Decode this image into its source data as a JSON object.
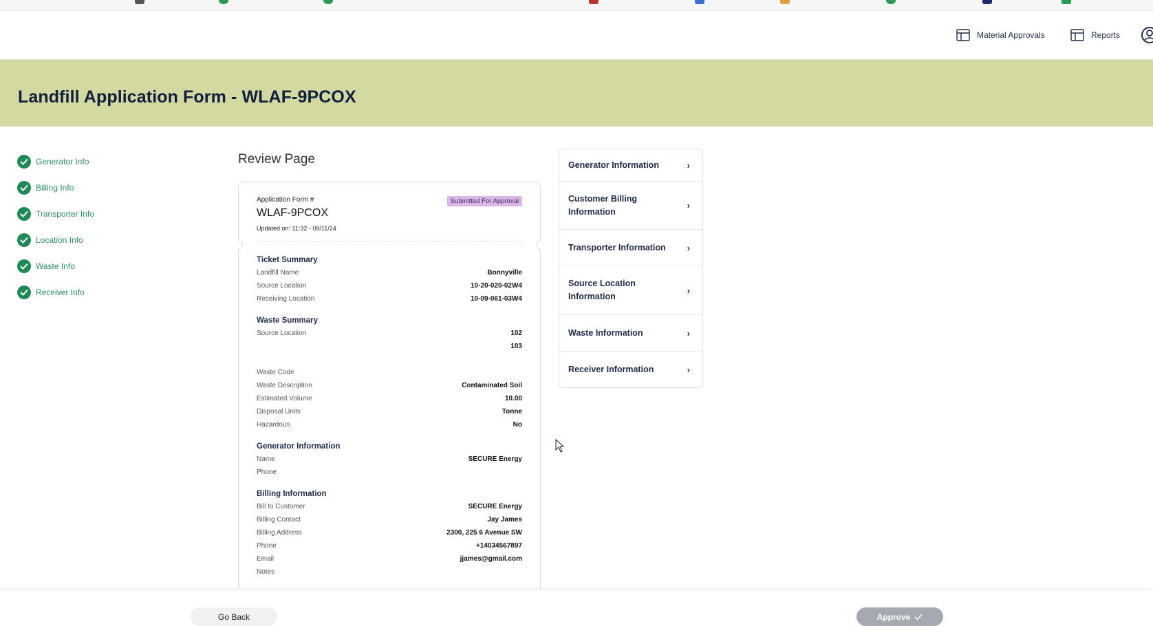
{
  "topbar": {
    "links": [
      {
        "label": "Material Approvals",
        "icon": "table-icon"
      },
      {
        "label": "Reports",
        "icon": "table-icon"
      }
    ],
    "user_icon": "user-circle-icon"
  },
  "banner": {
    "title": "Landfill Application Form - WLAF-9PCOX"
  },
  "steps": [
    {
      "label": "Generator Info",
      "status": "complete"
    },
    {
      "label": "Billing Info",
      "status": "complete"
    },
    {
      "label": "Transporter Info",
      "status": "complete"
    },
    {
      "label": "Location Info",
      "status": "complete"
    },
    {
      "label": "Waste Info",
      "status": "complete"
    },
    {
      "label": "Receiver Info",
      "status": "complete"
    }
  ],
  "review": {
    "title": "Review Page",
    "app_label": "Application Form #",
    "app_number": "WLAF-9PCOX",
    "updated": "Updated on: 11:32 - 09/11/24",
    "status": "Submitted For Approval",
    "ticket_summary": {
      "title": "Ticket Summary",
      "rows": [
        {
          "k": "Landfill Name",
          "v": "Bonnyville"
        },
        {
          "k": "Source Location",
          "v": "10-20-020-02W4"
        },
        {
          "k": "Receiving Location",
          "v": "10-09-061-03W4"
        }
      ]
    },
    "waste_summary": {
      "title": "Waste Summary",
      "rows": [
        {
          "k": "Source Location",
          "v": "102"
        },
        {
          "k": "",
          "v": "103"
        },
        {
          "k": "Waste Code",
          "v": ""
        },
        {
          "k": "Waste Description",
          "v": "Contaminated Soil"
        },
        {
          "k": "Estimated Volume",
          "v": "10.00"
        },
        {
          "k": "Disposal Units",
          "v": "Tonne"
        },
        {
          "k": "Hazardous",
          "v": "No"
        }
      ]
    },
    "generator_info": {
      "title": "Generator Information",
      "rows": [
        {
          "k": "Name",
          "v": "SECURE Energy"
        },
        {
          "k": "Phone",
          "v": ""
        }
      ]
    },
    "billing_info": {
      "title": "Billing Information",
      "rows": [
        {
          "k": "Bill to Customer",
          "v": "SECURE Energy"
        },
        {
          "k": "Billing Contact",
          "v": "Jay James"
        },
        {
          "k": "Billing Address",
          "v": "2300, 225 6 Avenue SW"
        },
        {
          "k": "Phone",
          "v": "+14034567897"
        },
        {
          "k": "Email",
          "v": "jjames@gmail.com"
        },
        {
          "k": "Notes",
          "v": ""
        }
      ]
    }
  },
  "accordion": [
    {
      "label": "Generator Information",
      "lines": 1
    },
    {
      "label": "Customer Billing Information",
      "lines": 2
    },
    {
      "label": "Transporter Information",
      "lines": 1
    },
    {
      "label": "Source Location Information",
      "lines": 2
    },
    {
      "label": "Waste Information",
      "lines": 1
    },
    {
      "label": "Receiver Information",
      "lines": 1
    }
  ],
  "footer": {
    "back_label": "Go Back",
    "approve_label": "Approve"
  },
  "colors": {
    "banner": "#d3d9a1",
    "check": "#1f8a57",
    "step_text": "#2f8a64",
    "badge": "#d9b8e8",
    "approve_disabled": "#a5a9b0"
  }
}
